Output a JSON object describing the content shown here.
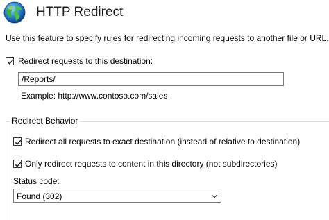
{
  "header": {
    "title": "HTTP Redirect",
    "icon": "globe-icon"
  },
  "description": "Use this feature to specify rules for redirecting incoming requests to another file or URL.",
  "redirect_destination": {
    "checkbox_label": "Redirect requests to this destination:",
    "checked": true,
    "value": "/Reports/",
    "example": "Example: http://www.contoso.com/sales"
  },
  "redirect_behavior": {
    "legend": "Redirect Behavior",
    "exact_destination": {
      "label": "Redirect all requests to exact destination (instead of relative to destination)",
      "checked": true
    },
    "only_this_directory": {
      "label": "Only redirect requests to content in this directory (not subdirectories)",
      "checked": true
    },
    "status_code": {
      "label": "Status code:",
      "selected": "Found (302)"
    }
  },
  "colors": {
    "checkmark": "#1a1a1a",
    "border": "#7a7a7a",
    "group_border": "#dcdcdc"
  }
}
